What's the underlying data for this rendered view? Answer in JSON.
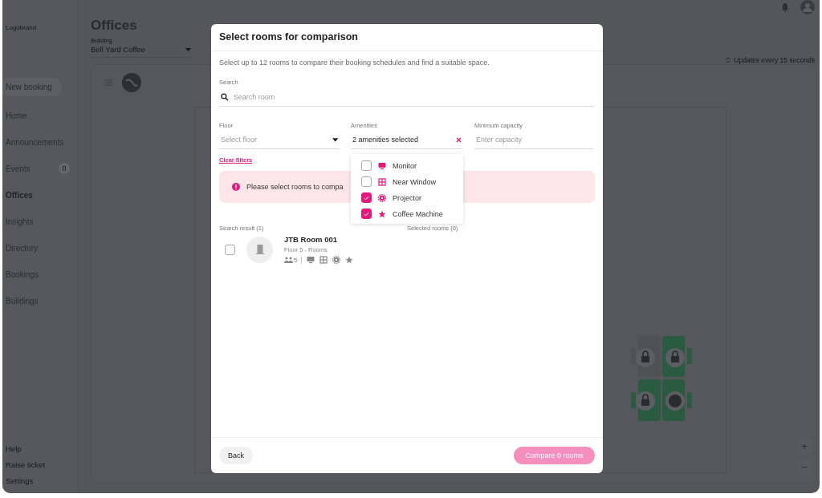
{
  "app": {
    "logo": "Logobrand",
    "new_booking": "New booking",
    "nav": [
      {
        "label": "Home",
        "selected": false
      },
      {
        "label": "Announcements",
        "selected": false
      },
      {
        "label": "Events",
        "selected": false,
        "badge": "0"
      },
      {
        "label": "Offices",
        "selected": true
      },
      {
        "label": "Insights",
        "selected": false
      },
      {
        "label": "Directory",
        "selected": false
      },
      {
        "label": "Bookings",
        "selected": false
      },
      {
        "label": "Buildings",
        "selected": false
      }
    ],
    "footer_nav": [
      "Help",
      "Raise ticket",
      "Settings"
    ],
    "page_title": "Offices",
    "building": {
      "label": "Building",
      "value": "Bell Yard Coffee"
    },
    "updates": "Updates every 15 seconds",
    "zoom": [
      "+",
      "−"
    ]
  },
  "modal": {
    "title": "Select rooms for comparison",
    "intro": "Select up to 12 rooms to compare their booking schedules and find a suitable space.",
    "search": {
      "label": "Search",
      "placeholder": "Search room"
    },
    "filters": [
      {
        "kind": "select",
        "label": "Floor",
        "placeholder": "Select floor"
      },
      {
        "kind": "multiselect",
        "label": "Amenities",
        "value": "2 amenities selected"
      },
      {
        "kind": "input",
        "label": "Minimum capacity",
        "placeholder": "Enter capacity"
      }
    ],
    "clear_filters": "Clear filters",
    "alert": "Please select rooms to compa",
    "amenity_options": [
      {
        "kind": "monitor",
        "label": "Monitor",
        "checked": false
      },
      {
        "kind": "window",
        "label": "Near Window",
        "checked": false
      },
      {
        "kind": "projector",
        "label": "Projector",
        "checked": true
      },
      {
        "kind": "coffee",
        "label": "Coffee Machine",
        "checked": true
      }
    ],
    "search_result_label": "Search result (1)",
    "selected_label": "Selected rooms (0)",
    "results": [
      {
        "name": "JTB Room 001",
        "subtitle": "Floor 5 - Rooms",
        "capacity": "5",
        "checked": false,
        "amenities": [
          {
            "kind": "monitor"
          },
          {
            "kind": "window"
          },
          {
            "kind": "projector"
          },
          {
            "kind": "coffee"
          }
        ]
      }
    ],
    "back": "Back",
    "compare": "Compare 0 rooms"
  }
}
